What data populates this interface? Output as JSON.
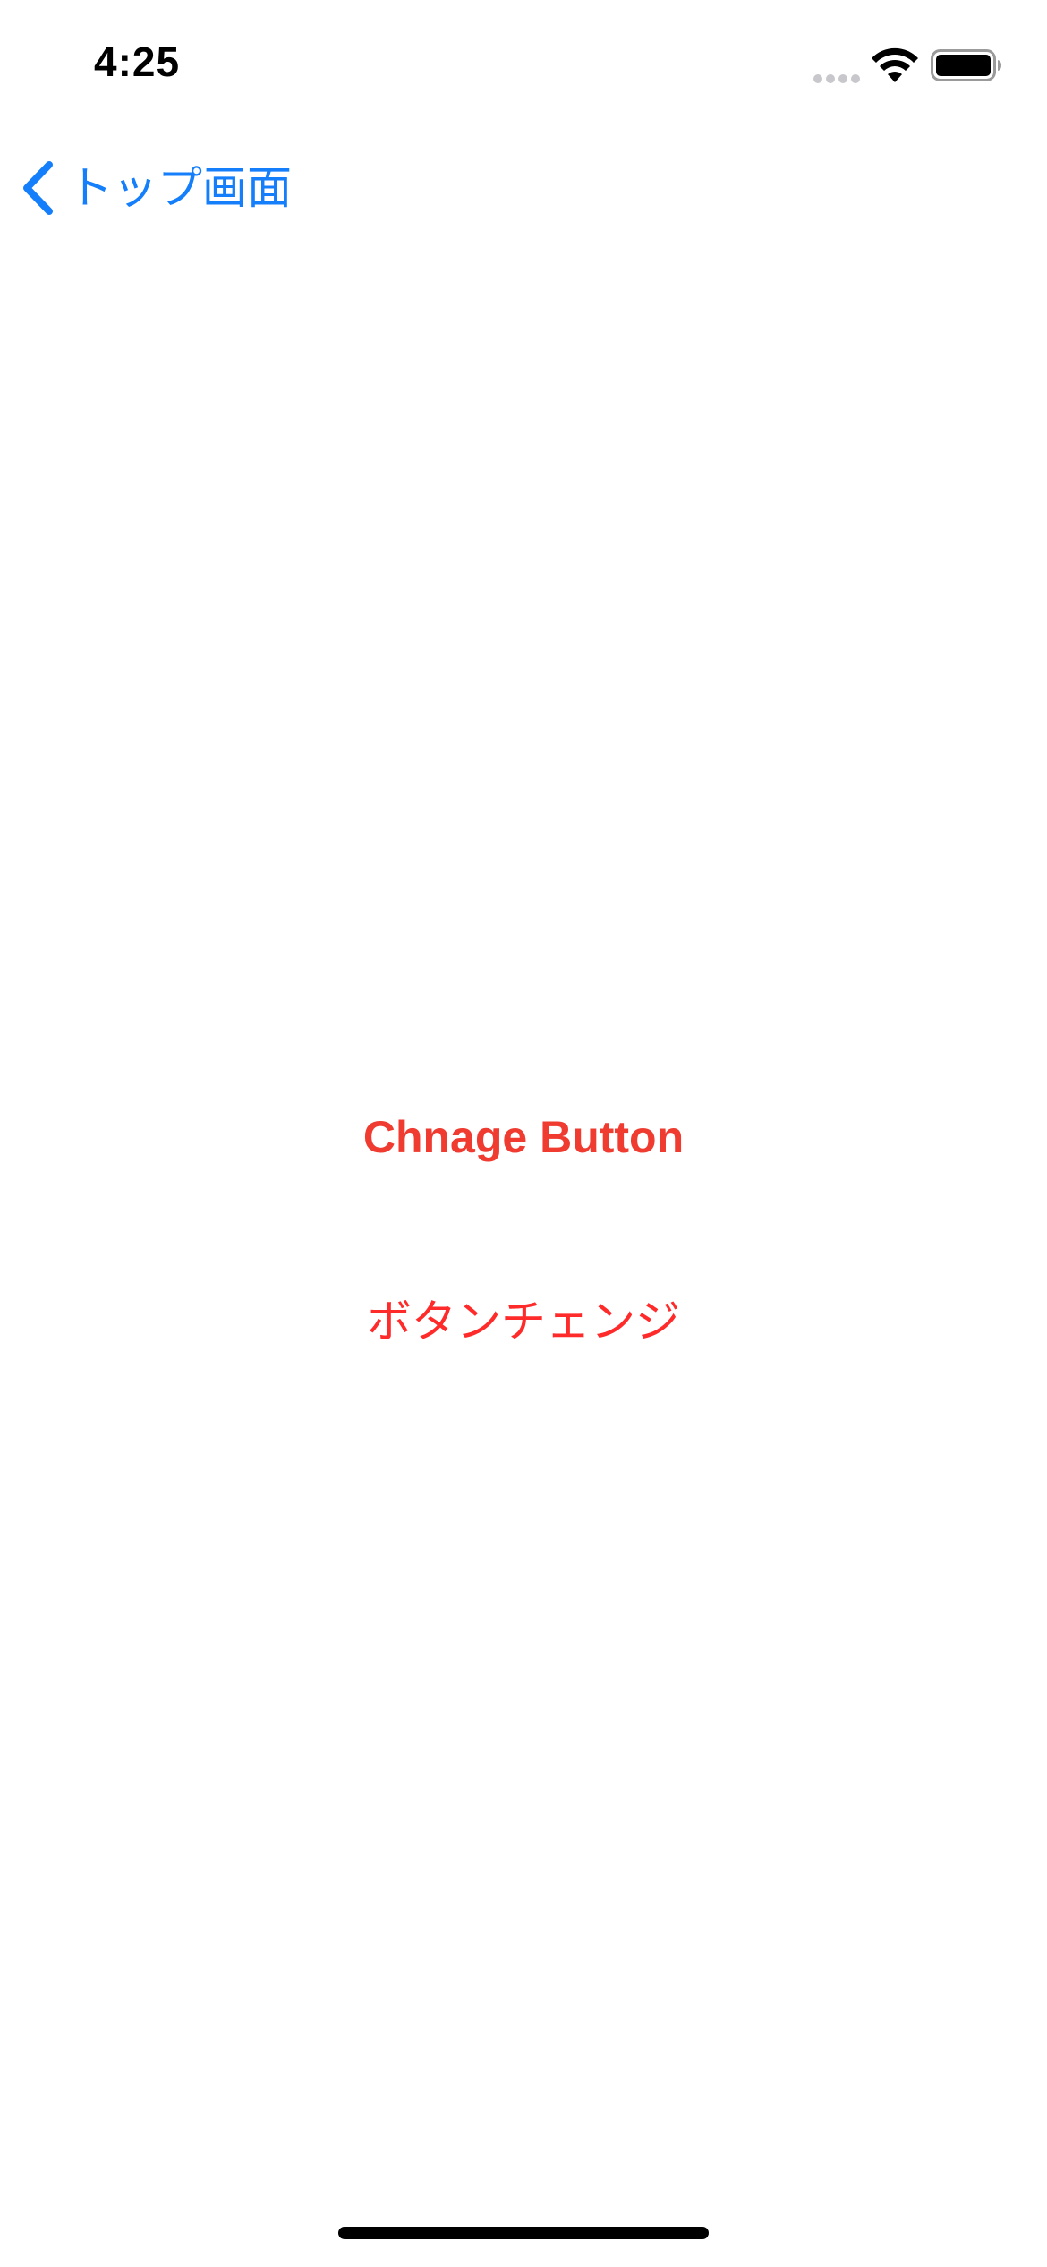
{
  "status_bar": {
    "time": "4:25",
    "icons": [
      "signal-dots-icon",
      "wifi-icon",
      "battery-icon"
    ]
  },
  "nav": {
    "back_label": "トップ画面",
    "back_icon": "chevron-left-icon"
  },
  "main": {
    "button_label": "Chnage Button",
    "text_label": "ボタンチェンジ"
  },
  "colors": {
    "nav_tint": "#147efb",
    "button_text": "#ef3b30",
    "label_text": "#ff2a2a",
    "background": "#ffffff"
  }
}
